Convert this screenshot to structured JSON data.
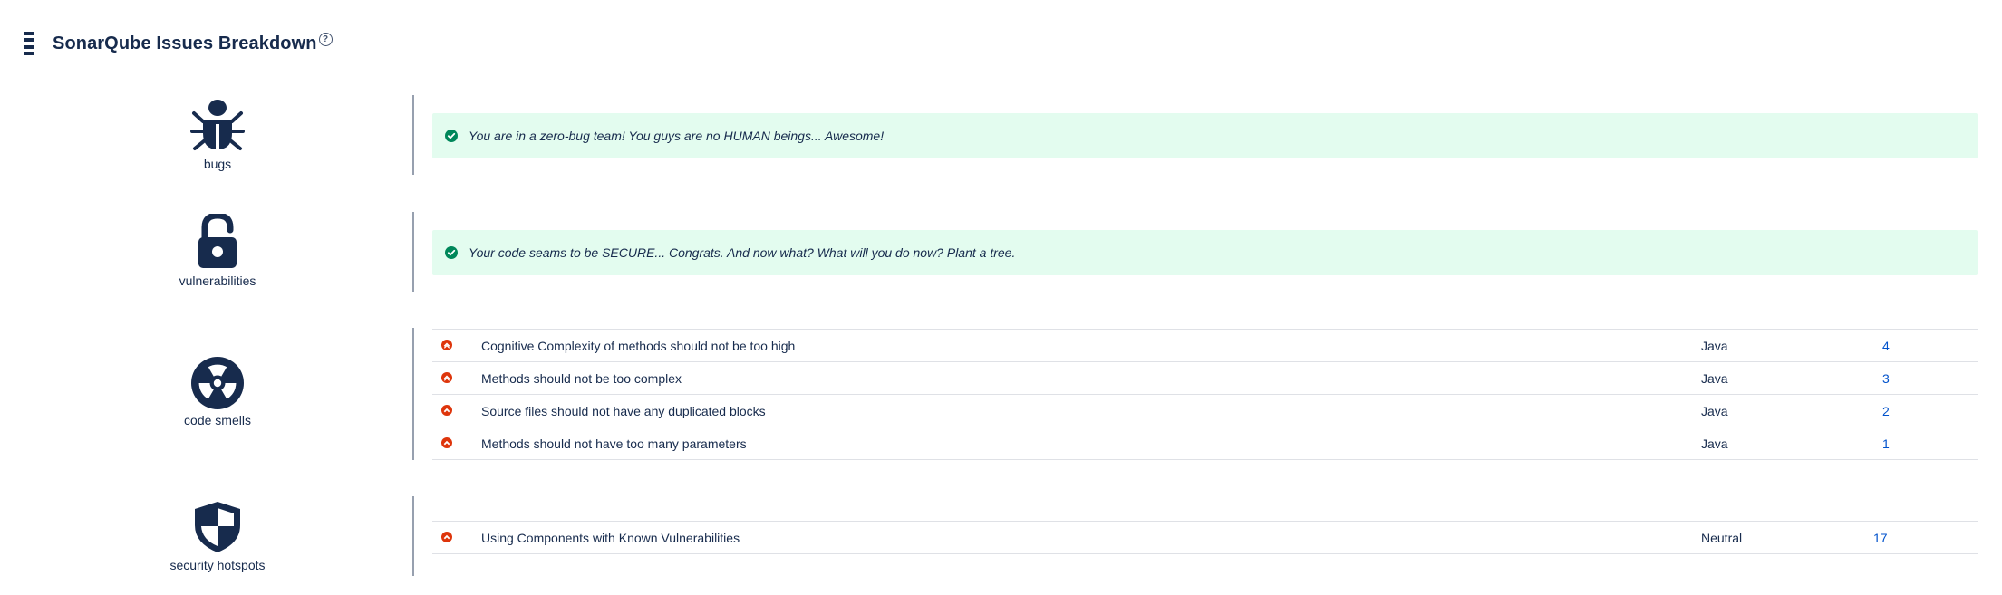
{
  "header": {
    "title": "SonarQube Issues Breakdown",
    "help_glyph": "?"
  },
  "colors": {
    "primary": "#172b4d",
    "success_bg": "#e3fcef",
    "success": "#00875a",
    "critical": "#de350b",
    "link": "#0052cc"
  },
  "sections": {
    "bugs": {
      "label": "bugs",
      "icon": "bug-icon",
      "message": "You are in a zero-bug team! You guys are no HUMAN beings... Awesome!"
    },
    "vulnerabilities": {
      "label": "vulnerabilities",
      "icon": "unlocked-padlock-icon",
      "message": "Your code seams to be SECURE... Congrats. And now what? What will you do now? Plant a tree."
    },
    "code_smells": {
      "label": "code smells",
      "icon": "radiation-icon",
      "issues": [
        {
          "rule": "Cognitive Complexity of methods should not be too high",
          "language": "Java",
          "count": "4",
          "severity_icon": "critical-severity-icon"
        },
        {
          "rule": "Methods should not be too complex",
          "language": "Java",
          "count": "3",
          "severity_icon": "critical-severity-icon"
        },
        {
          "rule": "Source files should not have any duplicated blocks",
          "language": "Java",
          "count": "2",
          "severity_icon": "major-severity-icon"
        },
        {
          "rule": "Methods should not have too many parameters",
          "language": "Java",
          "count": "1",
          "severity_icon": "major-severity-icon"
        }
      ]
    },
    "security_hotspots": {
      "label": "security hotspots",
      "icon": "shield-icon",
      "issues": [
        {
          "rule": "Using Components with Known Vulnerabilities",
          "language": "Neutral",
          "count": "17",
          "severity_icon": "major-severity-icon"
        }
      ]
    }
  }
}
